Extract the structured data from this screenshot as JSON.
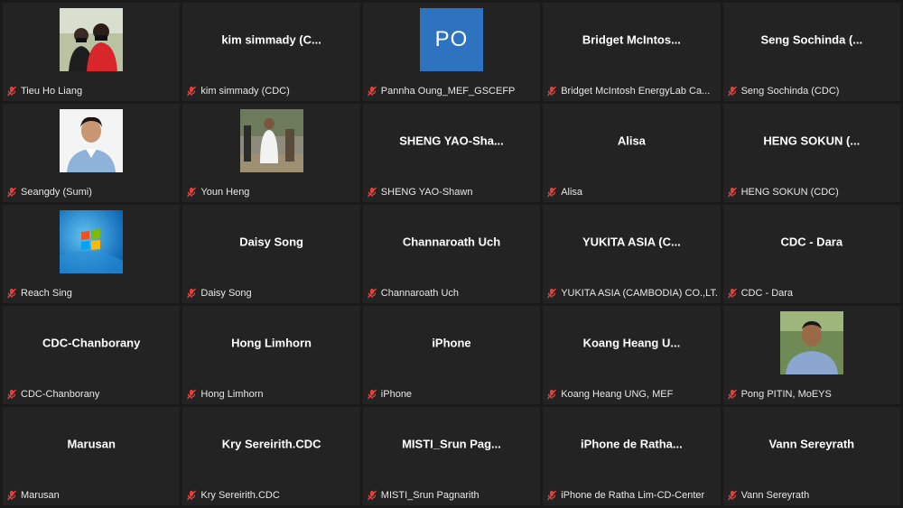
{
  "colors": {
    "background": "#1a1a1a",
    "tile": "#232323",
    "mute_icon": "#e0423a",
    "initials_avatar": "#2d73bf"
  },
  "participants": [
    {
      "display_name": "",
      "label": "Tieu Ho Liang",
      "avatar": "photo-two-people",
      "muted": true
    },
    {
      "display_name": "kim simmady (C...",
      "label": "kim simmady (CDC)",
      "avatar": "",
      "muted": true
    },
    {
      "display_name": "",
      "label": "Pannha Oung_MEF_GSCEFP",
      "avatar": "initials",
      "initials": "PO",
      "muted": true
    },
    {
      "display_name": "Bridget McIntos...",
      "label": "Bridget McIntosh EnergyLab Ca...",
      "avatar": "",
      "muted": true
    },
    {
      "display_name": "Seng Sochinda (...",
      "label": "Seng Sochinda (CDC)",
      "avatar": "",
      "muted": true
    },
    {
      "display_name": "",
      "label": "Seangdy (Sumi)",
      "avatar": "photo-portrait",
      "muted": true
    },
    {
      "display_name": "",
      "label": "Youn Heng",
      "avatar": "photo-outdoor",
      "muted": true
    },
    {
      "display_name": "SHENG YAO-Sha...",
      "label": "SHENG YAO-Shawn",
      "avatar": "",
      "muted": true
    },
    {
      "display_name": "Alisa",
      "label": "Alisa",
      "avatar": "",
      "muted": true
    },
    {
      "display_name": "HENG SOKUN (...",
      "label": "HENG SOKUN (CDC)",
      "avatar": "",
      "muted": true
    },
    {
      "display_name": "",
      "label": "Reach Sing",
      "avatar": "photo-windows-logo",
      "muted": true
    },
    {
      "display_name": "Daisy Song",
      "label": "Daisy Song",
      "avatar": "",
      "muted": true
    },
    {
      "display_name": "Channaroath Uch",
      "label": "Channaroath Uch",
      "avatar": "",
      "muted": true
    },
    {
      "display_name": "YUKITA ASIA (C...",
      "label": "YUKITA ASIA (CAMBODIA) CO.,LT...",
      "avatar": "",
      "muted": true
    },
    {
      "display_name": "CDC - Dara",
      "label": "CDC - Dara",
      "avatar": "",
      "muted": true
    },
    {
      "display_name": "CDC-Chanborany",
      "label": "CDC-Chanborany",
      "avatar": "",
      "muted": true
    },
    {
      "display_name": "Hong Limhorn",
      "label": "Hong Limhorn",
      "avatar": "",
      "muted": true
    },
    {
      "display_name": "iPhone",
      "label": "iPhone",
      "avatar": "",
      "muted": true
    },
    {
      "display_name": "Koang Heang U...",
      "label": "Koang Heang UNG, MEF",
      "avatar": "",
      "muted": true
    },
    {
      "display_name": "",
      "label": "Pong PITIN, MoEYS",
      "avatar": "photo-man-outdoor",
      "muted": true
    },
    {
      "display_name": "Marusan",
      "label": "Marusan",
      "avatar": "",
      "muted": true
    },
    {
      "display_name": "Kry Sereirith.CDC",
      "label": "Kry Sereirith.CDC",
      "avatar": "",
      "muted": true
    },
    {
      "display_name": "MISTI_Srun Pag...",
      "label": "MISTI_Srun Pagnarith",
      "avatar": "",
      "muted": true
    },
    {
      "display_name": "iPhone de Ratha...",
      "label": "iPhone de Ratha Lim-CD-Center",
      "avatar": "",
      "muted": true
    },
    {
      "display_name": "Vann Sereyrath",
      "label": "Vann Sereyrath",
      "avatar": "",
      "muted": true
    }
  ]
}
